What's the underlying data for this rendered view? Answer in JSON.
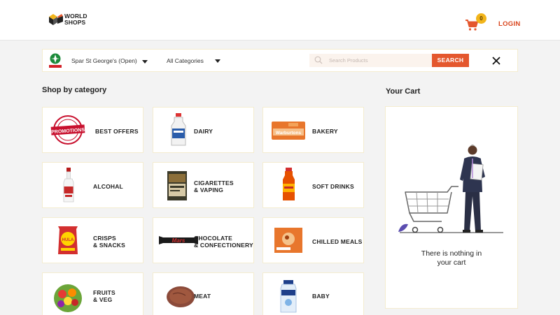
{
  "header": {
    "logo_text": "WORLD\nSHOPS",
    "cart_count": "0",
    "login_label": "LOGIN"
  },
  "searchbar": {
    "store": "Spar St George's (Open)",
    "category": "All Categories",
    "search_placeholder": "Search Products",
    "search_button": "SEARCH"
  },
  "shop": {
    "title": "Shop by category",
    "categories": [
      {
        "label": "BEST OFFERS",
        "icon": "promotions-badge-icon"
      },
      {
        "label": "DAIRY",
        "icon": "milk-bottle-icon"
      },
      {
        "label": "BAKERY",
        "icon": "bread-pack-icon"
      },
      {
        "label": "ALCOHAL",
        "icon": "vodka-bottle-icon"
      },
      {
        "label": "CIGARETTES\n& VAPING",
        "icon": "cigarette-pack-icon"
      },
      {
        "label": "SOFT DRINKS",
        "icon": "soda-bottle-icon"
      },
      {
        "label": "CRISPS\n& SNACKS",
        "icon": "crisps-bag-icon"
      },
      {
        "label": "CHOCOLATE\n& CONFECTIONERY",
        "icon": "chocolate-bar-icon"
      },
      {
        "label": "CHILLED MEALS",
        "icon": "ready-meal-icon"
      },
      {
        "label": "FRUITS\n& VEG",
        "icon": "fruit-veg-icon"
      },
      {
        "label": "MEAT",
        "icon": "meat-steak-icon"
      },
      {
        "label": "BABY",
        "icon": "baby-milk-bottle-icon"
      }
    ]
  },
  "cart": {
    "title": "Your Cart",
    "empty_message": "There is nothing in\nyour cart"
  },
  "colors": {
    "accent": "#e4572e",
    "badge": "#f2b51b",
    "tile_border": "#f4ecd0",
    "background": "#f3f3f3"
  }
}
